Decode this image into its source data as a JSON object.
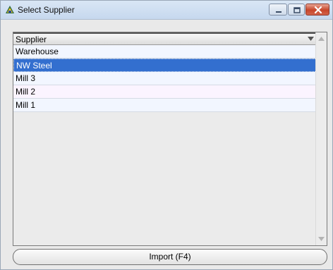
{
  "window": {
    "title": "Select Supplier",
    "icons": {
      "app": "supplier-app-icon",
      "minimize": "minimize-icon",
      "maximize": "maximize-icon",
      "close": "close-icon"
    }
  },
  "list": {
    "header": "Supplier",
    "sort_icon": "sort-down-icon",
    "rows": [
      {
        "label": "Warehouse",
        "selected": false
      },
      {
        "label": "NW Steel",
        "selected": true
      },
      {
        "label": "Mill 3",
        "selected": false
      },
      {
        "label": "Mill 2",
        "selected": false
      },
      {
        "label": "Mill 1",
        "selected": false
      }
    ]
  },
  "footer": {
    "import_label": "Import (F4)"
  },
  "colors": {
    "selection": "#336fcf",
    "row_tint_blue": "#f2f6ff",
    "row_tint_pink": "#fbf4ff",
    "close_button": "#c7462b"
  }
}
